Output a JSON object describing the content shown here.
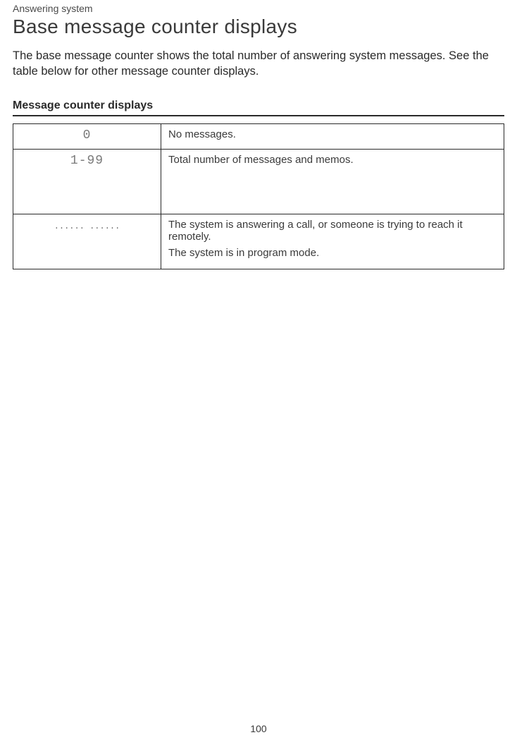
{
  "header": {
    "section": "Answering system",
    "title": "Base message counter displays"
  },
  "intro": "The base message counter shows the total number of answering system messages. See the table below for other message counter displays.",
  "table": {
    "heading": "Message counter displays",
    "rows": [
      {
        "display": "0",
        "descriptions": [
          "No messages."
        ]
      },
      {
        "display": "1-99",
        "descriptions": [
          "Total number of messages and memos."
        ]
      },
      {
        "display": "...... ......",
        "descriptions": [
          "The system is answering a call, or someone is trying to reach it remotely.",
          "The system is in program mode."
        ]
      }
    ]
  },
  "page_number": "100"
}
